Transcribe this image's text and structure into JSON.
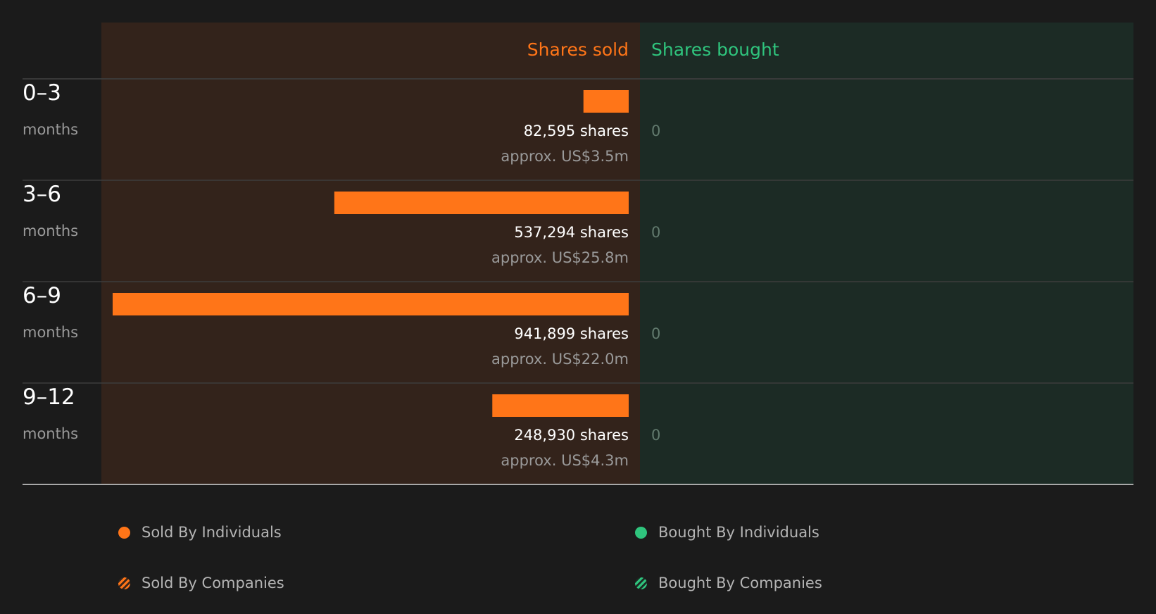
{
  "colors": {
    "background": "#1b1b1b",
    "sold_panel": "#33231b",
    "bought_panel": "#1c2b25",
    "sold_accent": "#ff7518",
    "bought_accent": "#2fc47d",
    "primary_text": "#ffffff",
    "secondary_text": "#9a9a9a",
    "zero_text": "#627a6e",
    "divider": "#3d3d3d",
    "baseline": "#a8a8a8",
    "legend_text": "#b4b4b4"
  },
  "chart_data": {
    "type": "bar",
    "columns": {
      "sold": "Shares sold",
      "bought": "Shares bought"
    },
    "period_unit": "months",
    "categories": [
      "0–3",
      "3–6",
      "6–9",
      "9–12"
    ],
    "series": [
      {
        "name": "Shares sold",
        "values": [
          82595,
          537294,
          941899,
          248930
        ],
        "value_labels": [
          "82,595 shares",
          "537,294 shares",
          "941,899 shares",
          "248,930 shares"
        ],
        "approx_labels": [
          "approx. US$3.5m",
          "approx. US$25.8m",
          "approx. US$22.0m",
          "approx. US$4.3m"
        ]
      },
      {
        "name": "Shares bought",
        "values": [
          0,
          0,
          0,
          0
        ],
        "value_labels": [
          "0",
          "0",
          "0",
          "0"
        ]
      }
    ],
    "xlim": [
      0,
      941899
    ]
  },
  "legend": {
    "sold_individuals": "Sold By Individuals",
    "sold_companies": "Sold By Companies",
    "bought_individuals": "Bought By Individuals",
    "bought_companies": "Bought By Companies"
  }
}
